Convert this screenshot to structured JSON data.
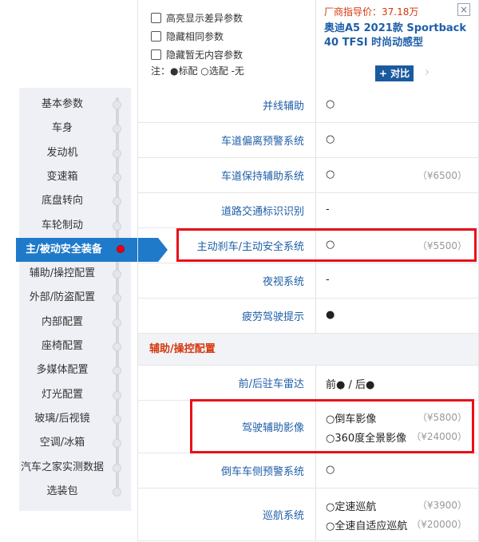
{
  "options": {
    "highlight_diff": "高亮显示差异参数",
    "hide_same": "隐藏相同参数",
    "hide_empty": "隐藏暂无内容参数",
    "legend": "注：●标配 ○选配 -无"
  },
  "car": {
    "price": "厂商指导价：37.18万",
    "close": "×",
    "name": "奥迪A5 2021款 Sportback 40 TFSI 时尚动感型",
    "compare": "+ 对比",
    "next": "›"
  },
  "nav": [
    {
      "label": "基本参数"
    },
    {
      "label": "车身"
    },
    {
      "label": "发动机"
    },
    {
      "label": "变速箱"
    },
    {
      "label": "底盘转向"
    },
    {
      "label": "车轮制动"
    },
    {
      "label": "主/被动安全装备"
    },
    {
      "label": "辅助/操控配置"
    },
    {
      "label": "外部/防盗配置"
    },
    {
      "label": "内部配置"
    },
    {
      "label": "座椅配置"
    },
    {
      "label": "多媒体配置"
    },
    {
      "label": "灯光配置"
    },
    {
      "label": "玻璃/后视镜"
    },
    {
      "label": "空调/冰箱"
    },
    {
      "label": "汽车之家实测数据"
    },
    {
      "label": "选装包"
    }
  ],
  "rows": [
    {
      "label": "并线辅助",
      "value": "○",
      "price": ""
    },
    {
      "label": "车道偏离预警系统",
      "value": "○",
      "price": ""
    },
    {
      "label": "车道保持辅助系统",
      "value": "○",
      "price": "（¥6500）"
    },
    {
      "label": "道路交通标识识别",
      "value": "-",
      "price": ""
    },
    {
      "label": "主动刹车/主动安全系统",
      "value": "○",
      "price": "（¥5500）"
    },
    {
      "label": "夜视系统",
      "value": "-",
      "price": ""
    },
    {
      "label": "疲劳驾驶提示",
      "value": "●",
      "price": ""
    }
  ],
  "section": "辅助/操控配置",
  "rows2": [
    {
      "label": "前/后驻车雷达",
      "value": "前● / 后●"
    },
    {
      "label": "驾驶辅助影像",
      "lines": [
        {
          "value": "○倒车影像",
          "price": "（¥5800）"
        },
        {
          "value": "○360度全景影像",
          "price": "（¥24000）"
        }
      ]
    },
    {
      "label": "倒车车侧预警系统",
      "value": "○"
    },
    {
      "label": "巡航系统",
      "lines": [
        {
          "value": "○定速巡航",
          "price": "（¥3900）"
        },
        {
          "value": "○全速自适应巡航",
          "price": "（¥20000）"
        }
      ]
    }
  ]
}
